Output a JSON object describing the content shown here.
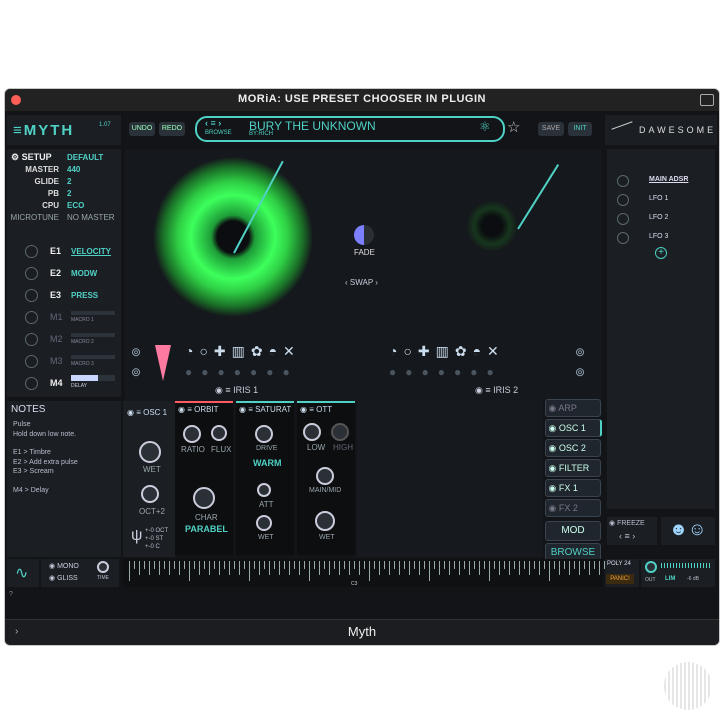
{
  "window": {
    "title": "MORiA: USE PRESET CHOOSER IN PLUGIN",
    "footer_title": "Myth"
  },
  "header": {
    "logo": "≡MYTH",
    "version": "1.07",
    "undo": "UNDO",
    "redo": "REDO",
    "browse": "BROWSE",
    "preset_name": "BURY THE UNKNOWN",
    "preset_author": "BY:RICH",
    "save": "SAVE",
    "init": "INIT",
    "brand": "DAWESOME"
  },
  "setup": {
    "title": "SETUP",
    "value": "DEFAULT",
    "rows": [
      {
        "label": "MASTER",
        "value": "440"
      },
      {
        "label": "GLIDE",
        "value": "2"
      },
      {
        "label": "PB",
        "value": "2"
      },
      {
        "label": "CPU",
        "value": "ECO"
      },
      {
        "label": "MICROTUNE",
        "value": "NO MASTER"
      }
    ]
  },
  "expr": [
    {
      "label": "E1",
      "value": "VELOCITY"
    },
    {
      "label": "E2",
      "value": "MODW"
    },
    {
      "label": "E3",
      "value": "PRESS"
    }
  ],
  "macros": [
    {
      "label": "M1",
      "name": "MACRO 1"
    },
    {
      "label": "M2",
      "name": "MACRO 2"
    },
    {
      "label": "M3",
      "name": "MACRO 3"
    },
    {
      "label": "M4",
      "name": "DELAY"
    }
  ],
  "notes": {
    "title": "NOTES",
    "lines": [
      "Pulse",
      "Hold down low note.",
      "",
      "E1 > Timbre",
      "E2 > Add extra pulse",
      "E3 > Scream",
      "",
      "M4 > Delay"
    ]
  },
  "center": {
    "fade": "FADE",
    "swap": "SWAP",
    "iris1": "IRIS 1",
    "iris2": "IRIS 2"
  },
  "osc": {
    "title": "OSC 1",
    "wet": "WET",
    "oct": "OCT+2",
    "tune": [
      "+-0 OCT",
      "+-0 ST",
      "+-0 C"
    ]
  },
  "modules": {
    "orbit": {
      "title": "ORBIT",
      "ratio": "RATIO",
      "flux": "FLUX",
      "char": "CHAR",
      "mode": "PARABEL"
    },
    "saturat": {
      "title": "SATURAT",
      "drive": "DRIVE",
      "mode": "WARM",
      "att": "ATT",
      "wet": "WET"
    },
    "ott": {
      "title": "OTT",
      "low": "LOW",
      "high": "HIGH",
      "mainmid": "MAIN/MID",
      "wet": "WET"
    }
  },
  "right_tabs": [
    "ARP",
    "OSC 1",
    "OSC 2",
    "FILTER",
    "FX 1",
    "FX 2"
  ],
  "mod_button": "MOD",
  "browse_button": "BROWSE",
  "mod_list": [
    "MAIN ADSR",
    "LFO 1",
    "LFO 2",
    "LFO 3"
  ],
  "freeze": "FREEZE",
  "bottom": {
    "mono": "MONO",
    "gliss": "GLISS",
    "time": "TIME",
    "key_label": "C3",
    "poly": "POLY 24",
    "panic": "PANIC!",
    "out": "OUT",
    "lim": "LIM",
    "db": "-6 dB",
    "help": "?"
  },
  "colors": {
    "accent": "#4fd1c5",
    "green": "#39ff5a",
    "bg": "#121417"
  }
}
